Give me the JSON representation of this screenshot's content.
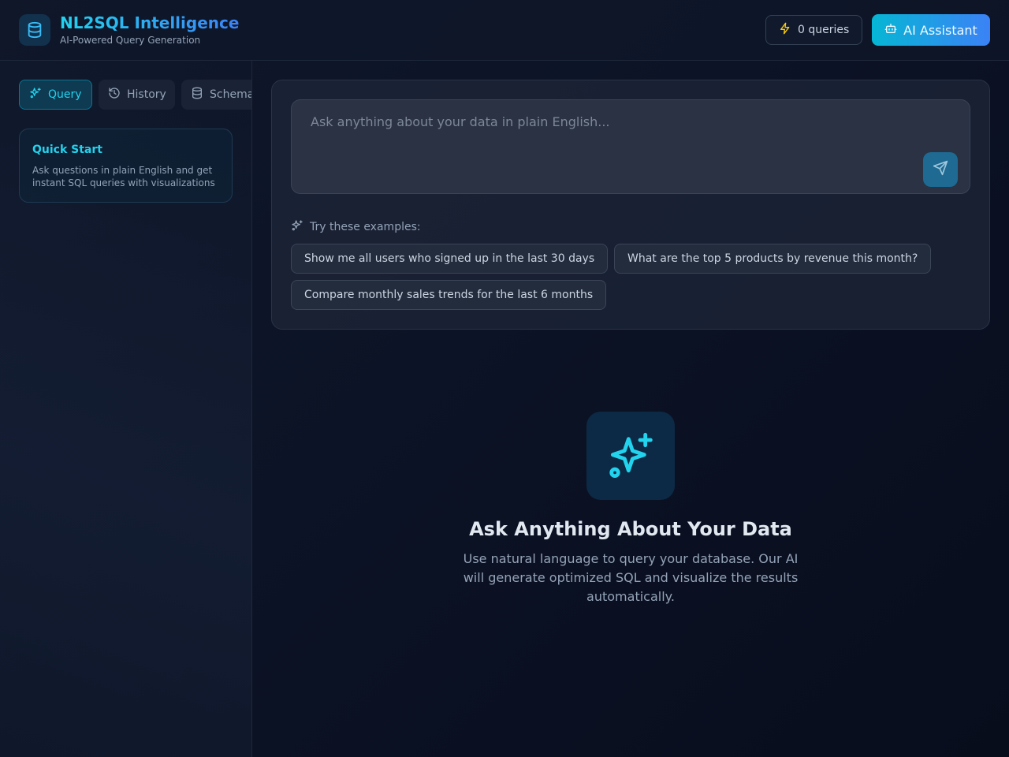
{
  "header": {
    "title": "NL2SQL Intelligence",
    "subtitle": "AI-Powered Query Generation",
    "queries_count": "0 queries",
    "ai_button": "AI Assistant"
  },
  "sidebar": {
    "tabs": [
      {
        "label": "Query",
        "icon": "sparkles-icon",
        "active": true
      },
      {
        "label": "History",
        "icon": "history-icon",
        "active": false
      },
      {
        "label": "Schema",
        "icon": "database-icon",
        "active": false
      }
    ],
    "quick_start": {
      "title": "Quick Start",
      "text": "Ask questions in plain English and get instant SQL queries with visualizations"
    }
  },
  "query": {
    "placeholder": "Ask anything about your data in plain English...",
    "value": "",
    "examples_label": "Try these examples:",
    "examples": [
      "Show me all users who signed up in the last 30 days",
      "What are the top 5 products by revenue this month?",
      "Compare monthly sales trends for the last 6 months"
    ]
  },
  "empty_state": {
    "title": "Ask Anything About Your Data",
    "text": "Use natural language to query your database. Our AI will generate optimized SQL and visualize the results automatically."
  },
  "colors": {
    "accent": "#22d3ee",
    "accent_blue": "#3b82f6",
    "background": "#0f172a"
  }
}
